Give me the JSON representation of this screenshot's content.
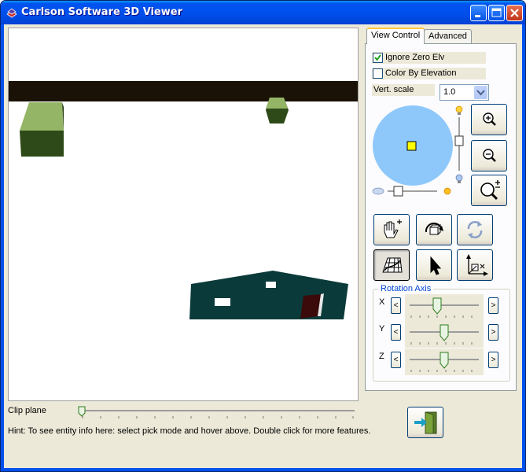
{
  "window": {
    "title": "Carlson Software 3D Viewer",
    "title_icon": "app-logo-icon",
    "controls": [
      "minimize-icon",
      "maximize-icon",
      "close-icon"
    ]
  },
  "tabs": [
    {
      "label": "View Control",
      "active": true
    },
    {
      "label": "Advanced",
      "active": false
    }
  ],
  "options": {
    "ignore_zero_elv": {
      "label": "Ignore Zero Elv",
      "checked": true
    },
    "color_by_elevation": {
      "label": "Color By Elevation",
      "checked": false
    }
  },
  "vert_scale": {
    "label": "Vert. scale",
    "value": "1.0"
  },
  "zoom_buttons": [
    "zoom-in-icon",
    "zoom-out-icon",
    "zoom-extents-icon"
  ],
  "tool_buttons": [
    "pan-hand-icon",
    "orbit-icon",
    "auto-rotate-icon",
    "walk-grid-icon",
    "pick-pointer-icon",
    "axis-icon"
  ],
  "rotation_axis": {
    "title": "Rotation Axis",
    "axes": [
      {
        "name": "X",
        "value": 0.3
      },
      {
        "name": "Y",
        "value": 0.5
      },
      {
        "name": "Z",
        "value": 0.5
      }
    ]
  },
  "light": {
    "brightness": 0.5,
    "intensity": 0.3
  },
  "clip_plane": {
    "label": "Clip plane",
    "value": 0
  },
  "hint": "Hint: To see entity info here: select pick mode and hover above. Double click for more features.",
  "exit_button": "exit-door-icon",
  "colors": {
    "title_bar": "#0050ee",
    "viewport_bg": "#ffffff",
    "ground_bar": "#1a1206",
    "box_top": "#93b565",
    "box_side": "#2e4a18",
    "building": "#0b3a3a",
    "door": "#3b0a0a",
    "trackball": "#8ec8fb"
  }
}
